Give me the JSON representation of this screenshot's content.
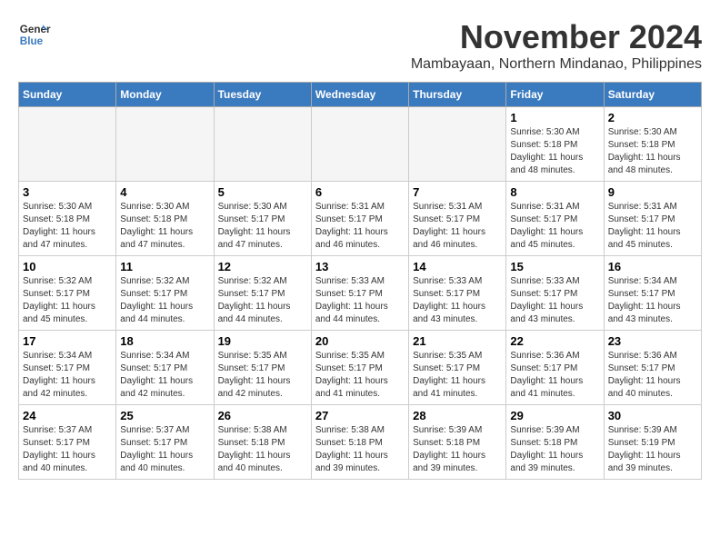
{
  "header": {
    "logo_line1": "General",
    "logo_line2": "Blue",
    "month_year": "November 2024",
    "location": "Mambayaan, Northern Mindanao, Philippines"
  },
  "days_of_week": [
    "Sunday",
    "Monday",
    "Tuesday",
    "Wednesday",
    "Thursday",
    "Friday",
    "Saturday"
  ],
  "weeks": [
    [
      {
        "day": "",
        "info": ""
      },
      {
        "day": "",
        "info": ""
      },
      {
        "day": "",
        "info": ""
      },
      {
        "day": "",
        "info": ""
      },
      {
        "day": "",
        "info": ""
      },
      {
        "day": "1",
        "info": "Sunrise: 5:30 AM\nSunset: 5:18 PM\nDaylight: 11 hours\nand 48 minutes."
      },
      {
        "day": "2",
        "info": "Sunrise: 5:30 AM\nSunset: 5:18 PM\nDaylight: 11 hours\nand 48 minutes."
      }
    ],
    [
      {
        "day": "3",
        "info": "Sunrise: 5:30 AM\nSunset: 5:18 PM\nDaylight: 11 hours\nand 47 minutes."
      },
      {
        "day": "4",
        "info": "Sunrise: 5:30 AM\nSunset: 5:18 PM\nDaylight: 11 hours\nand 47 minutes."
      },
      {
        "day": "5",
        "info": "Sunrise: 5:30 AM\nSunset: 5:17 PM\nDaylight: 11 hours\nand 47 minutes."
      },
      {
        "day": "6",
        "info": "Sunrise: 5:31 AM\nSunset: 5:17 PM\nDaylight: 11 hours\nand 46 minutes."
      },
      {
        "day": "7",
        "info": "Sunrise: 5:31 AM\nSunset: 5:17 PM\nDaylight: 11 hours\nand 46 minutes."
      },
      {
        "day": "8",
        "info": "Sunrise: 5:31 AM\nSunset: 5:17 PM\nDaylight: 11 hours\nand 45 minutes."
      },
      {
        "day": "9",
        "info": "Sunrise: 5:31 AM\nSunset: 5:17 PM\nDaylight: 11 hours\nand 45 minutes."
      }
    ],
    [
      {
        "day": "10",
        "info": "Sunrise: 5:32 AM\nSunset: 5:17 PM\nDaylight: 11 hours\nand 45 minutes."
      },
      {
        "day": "11",
        "info": "Sunrise: 5:32 AM\nSunset: 5:17 PM\nDaylight: 11 hours\nand 44 minutes."
      },
      {
        "day": "12",
        "info": "Sunrise: 5:32 AM\nSunset: 5:17 PM\nDaylight: 11 hours\nand 44 minutes."
      },
      {
        "day": "13",
        "info": "Sunrise: 5:33 AM\nSunset: 5:17 PM\nDaylight: 11 hours\nand 44 minutes."
      },
      {
        "day": "14",
        "info": "Sunrise: 5:33 AM\nSunset: 5:17 PM\nDaylight: 11 hours\nand 43 minutes."
      },
      {
        "day": "15",
        "info": "Sunrise: 5:33 AM\nSunset: 5:17 PM\nDaylight: 11 hours\nand 43 minutes."
      },
      {
        "day": "16",
        "info": "Sunrise: 5:34 AM\nSunset: 5:17 PM\nDaylight: 11 hours\nand 43 minutes."
      }
    ],
    [
      {
        "day": "17",
        "info": "Sunrise: 5:34 AM\nSunset: 5:17 PM\nDaylight: 11 hours\nand 42 minutes."
      },
      {
        "day": "18",
        "info": "Sunrise: 5:34 AM\nSunset: 5:17 PM\nDaylight: 11 hours\nand 42 minutes."
      },
      {
        "day": "19",
        "info": "Sunrise: 5:35 AM\nSunset: 5:17 PM\nDaylight: 11 hours\nand 42 minutes."
      },
      {
        "day": "20",
        "info": "Sunrise: 5:35 AM\nSunset: 5:17 PM\nDaylight: 11 hours\nand 41 minutes."
      },
      {
        "day": "21",
        "info": "Sunrise: 5:35 AM\nSunset: 5:17 PM\nDaylight: 11 hours\nand 41 minutes."
      },
      {
        "day": "22",
        "info": "Sunrise: 5:36 AM\nSunset: 5:17 PM\nDaylight: 11 hours\nand 41 minutes."
      },
      {
        "day": "23",
        "info": "Sunrise: 5:36 AM\nSunset: 5:17 PM\nDaylight: 11 hours\nand 40 minutes."
      }
    ],
    [
      {
        "day": "24",
        "info": "Sunrise: 5:37 AM\nSunset: 5:17 PM\nDaylight: 11 hours\nand 40 minutes."
      },
      {
        "day": "25",
        "info": "Sunrise: 5:37 AM\nSunset: 5:17 PM\nDaylight: 11 hours\nand 40 minutes."
      },
      {
        "day": "26",
        "info": "Sunrise: 5:38 AM\nSunset: 5:18 PM\nDaylight: 11 hours\nand 40 minutes."
      },
      {
        "day": "27",
        "info": "Sunrise: 5:38 AM\nSunset: 5:18 PM\nDaylight: 11 hours\nand 39 minutes."
      },
      {
        "day": "28",
        "info": "Sunrise: 5:39 AM\nSunset: 5:18 PM\nDaylight: 11 hours\nand 39 minutes."
      },
      {
        "day": "29",
        "info": "Sunrise: 5:39 AM\nSunset: 5:18 PM\nDaylight: 11 hours\nand 39 minutes."
      },
      {
        "day": "30",
        "info": "Sunrise: 5:39 AM\nSunset: 5:19 PM\nDaylight: 11 hours\nand 39 minutes."
      }
    ]
  ]
}
